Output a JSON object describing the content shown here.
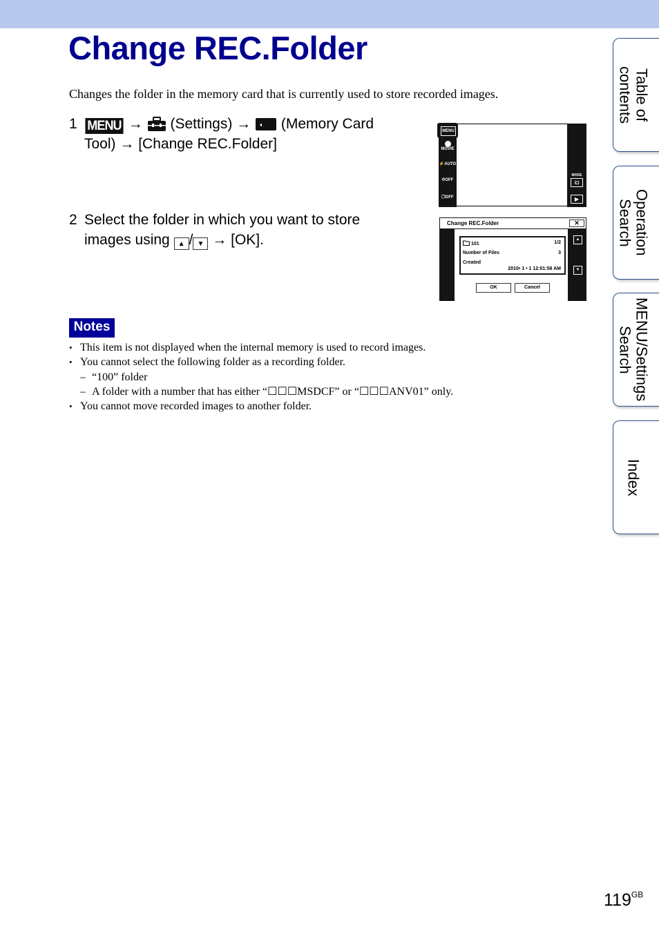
{
  "page": {
    "title": "Change REC.Folder",
    "intro": "Changes the folder in the memory card that is currently used to store recorded images.",
    "page_number": "119",
    "page_suffix": "GB"
  },
  "steps": [
    {
      "number": "1",
      "menu_label": "MENU",
      "arrow": "→",
      "settings_text": "(Settings)",
      "memory_card_text": "(Memory Card Tool)",
      "final_text": "[Change REC.Folder]"
    },
    {
      "number": "2",
      "text_before": "Select the folder in which you want to store images using",
      "separator": "/",
      "arrow": "→",
      "text_after": "[OK]."
    }
  ],
  "screen1": {
    "menu_button": "MENU",
    "left_icons": [
      "MOVIE",
      "⚡AUTO",
      "⏱OFF",
      "❐OFF"
    ],
    "mode_label": "MODE",
    "camera_icon": "i◘",
    "play_icon": "▶"
  },
  "screen2": {
    "title": "Change REC.Folder",
    "close": "✕",
    "folder_name": "101",
    "page_indicator": "1/2",
    "files_label": "Number of Files",
    "files_value": "3",
    "created_label": "Created",
    "created_value": "2010• 1 • 1  12:01:58 AM",
    "ok_label": "OK",
    "cancel_label": "Cancel",
    "up": "▲",
    "down": "▼"
  },
  "notes": {
    "label": "Notes",
    "items": [
      {
        "type": "bullet",
        "text": "This item is not displayed when the internal memory is used to record images."
      },
      {
        "type": "bullet",
        "text": "You cannot select the following folder as a recording folder."
      },
      {
        "type": "sub",
        "text": "“100” folder"
      },
      {
        "type": "sub",
        "text": "A folder with a number that has either “☐☐☐MSDCF” or “☐☐☐ANV01” only."
      },
      {
        "type": "bullet",
        "text": "You cannot move recorded images to another folder."
      }
    ]
  },
  "side_tabs": [
    {
      "label": "Table of\ncontents"
    },
    {
      "label": "Operation\nSearch"
    },
    {
      "label": "MENU/Settings\nSearch"
    },
    {
      "label": "Index"
    }
  ]
}
